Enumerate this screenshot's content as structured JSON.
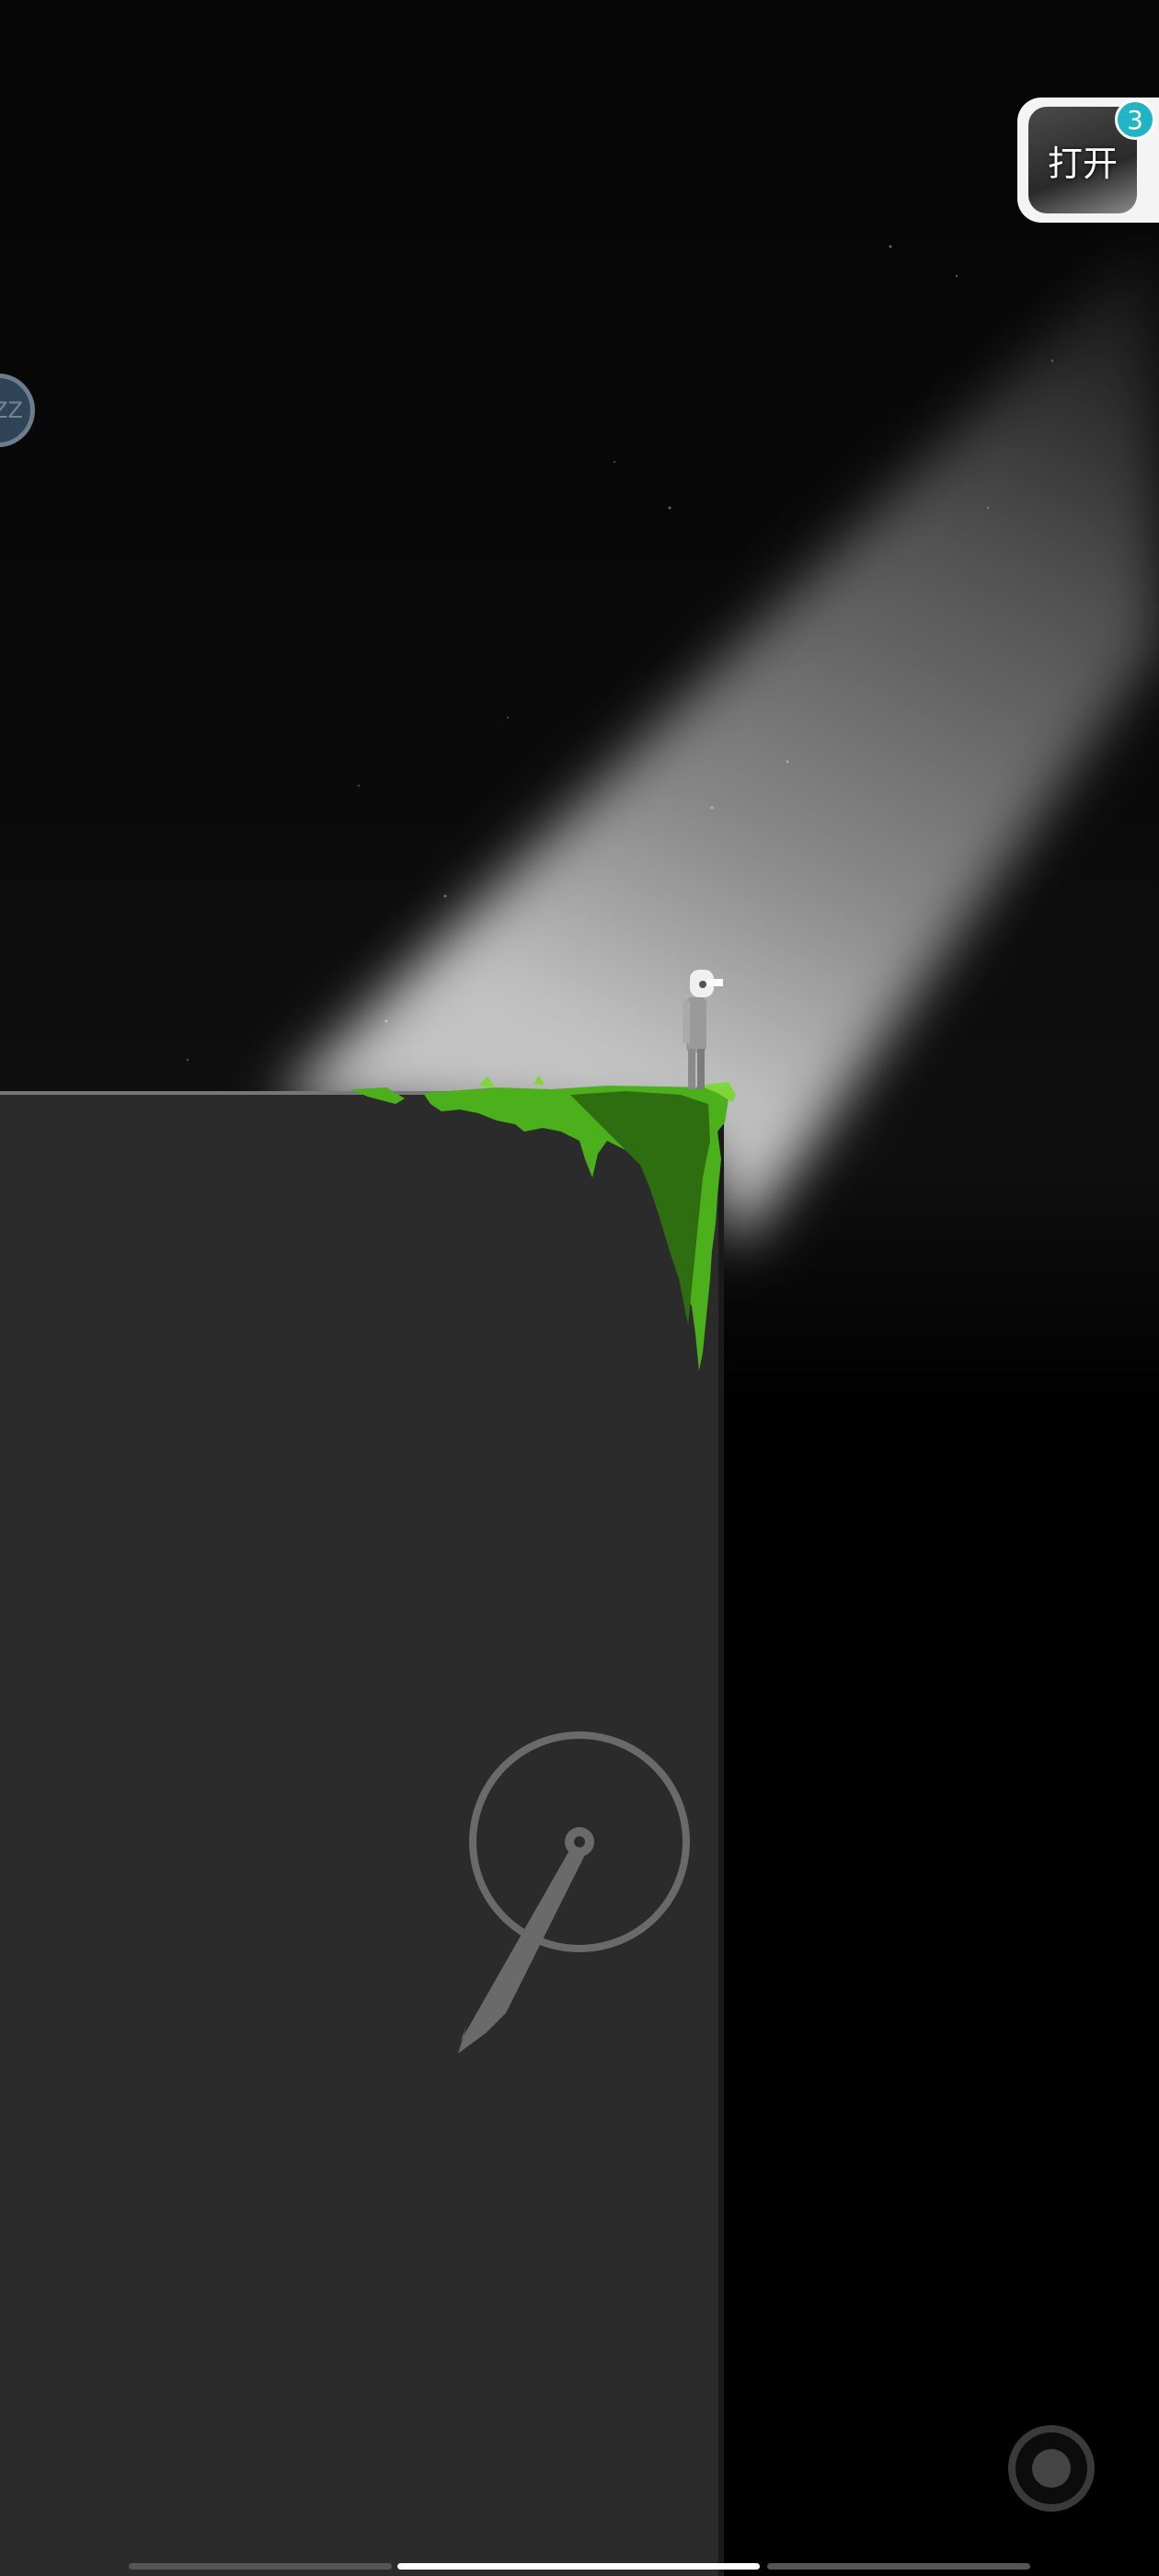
{
  "open_badge": {
    "label": "打开",
    "count": "3",
    "icon": "app-thumbnail"
  },
  "sleep_button": {
    "label": "ZZ",
    "icon": "sleep-icon"
  },
  "joystick": {
    "icon": "joystick-arrow-icon"
  },
  "action_button": {
    "icon": "circle-action-icon"
  },
  "colors": {
    "moss": "#4caf1c",
    "moss_dark": "#2f6e10",
    "cliff": "#2b2b2b",
    "badge": "#1fb5c7"
  }
}
